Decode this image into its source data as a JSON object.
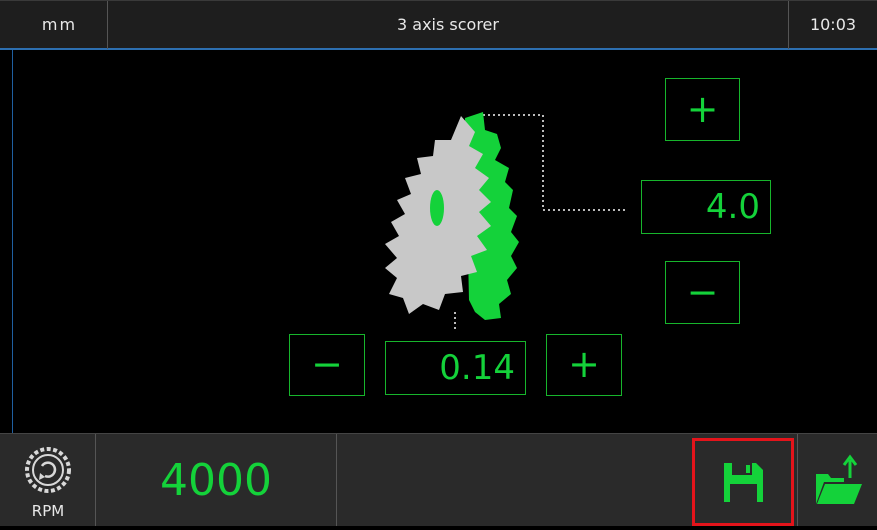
{
  "header": {
    "unit": "mm",
    "title": "3 axis scorer",
    "time": "10:03"
  },
  "vertical_adjust": {
    "value": "4.0",
    "increase_symbol": "+",
    "decrease_symbol": "−"
  },
  "horizontal_adjust": {
    "value": "0.14",
    "increase_symbol": "+",
    "decrease_symbol": "−"
  },
  "footer": {
    "rpm_label": "RPM",
    "rpm_value": "4000",
    "icons": [
      "saw-blade-speed-icon",
      "save-icon",
      "open-folder-icon"
    ]
  },
  "colors": {
    "accent_green": "#14d23a",
    "blade_grey": "#c8c8c8",
    "highlight_red": "#e4141b",
    "header_border_blue": "#2d6fb0"
  }
}
